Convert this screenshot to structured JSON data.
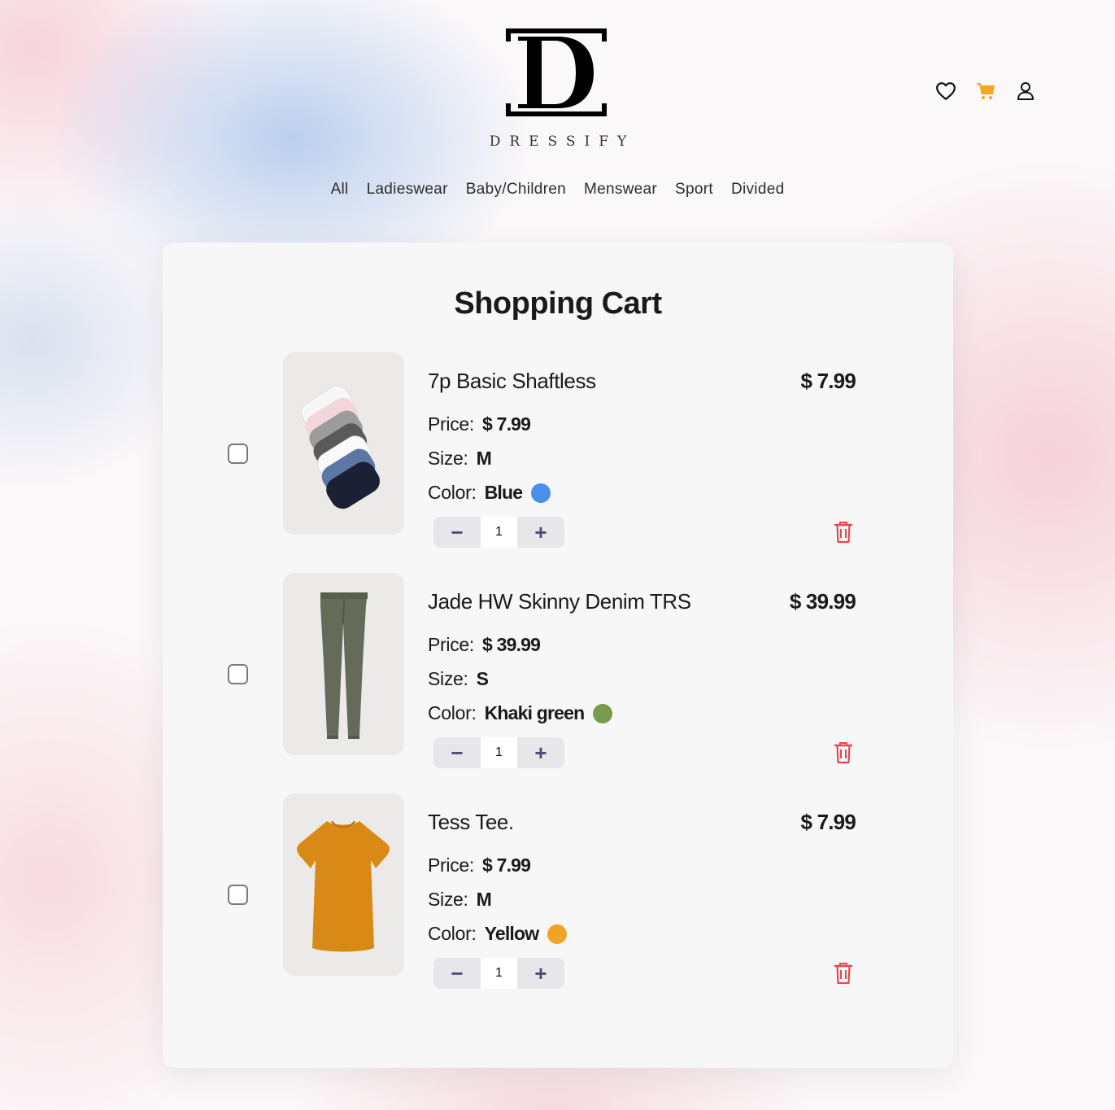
{
  "brand": {
    "name": "DRESSIFY",
    "logo_letter": "D"
  },
  "header_icons": [
    "heart-icon",
    "cart-icon",
    "user-icon"
  ],
  "colors": {
    "cart_accent": "#f5a623",
    "delete": "#e5484d",
    "qty_button": "#4f4a7a"
  },
  "nav": [
    "All",
    "Ladieswear",
    "Baby/Children",
    "Menswear",
    "Sport",
    "Divided"
  ],
  "cart": {
    "title": "Shopping Cart",
    "price_label": "Price:",
    "size_label": "Size:",
    "color_label": "Color:",
    "items": [
      {
        "name": "7p Basic Shaftless",
        "total": "$ 7.99",
        "price": "$ 7.99",
        "size": "M",
        "color": "Blue",
        "swatch": "#4a8fea",
        "quantity": "1",
        "checked": false
      },
      {
        "name": "Jade HW Skinny Denim TRS",
        "total": "$ 39.99",
        "price": "$ 39.99",
        "size": "S",
        "color": "Khaki green",
        "swatch": "#7a9b4c",
        "quantity": "1",
        "checked": false
      },
      {
        "name": "Tess Tee.",
        "total": "$ 7.99",
        "price": "$ 7.99",
        "size": "M",
        "color": "Yellow",
        "swatch": "#f0a424",
        "quantity": "1",
        "checked": false
      }
    ]
  }
}
